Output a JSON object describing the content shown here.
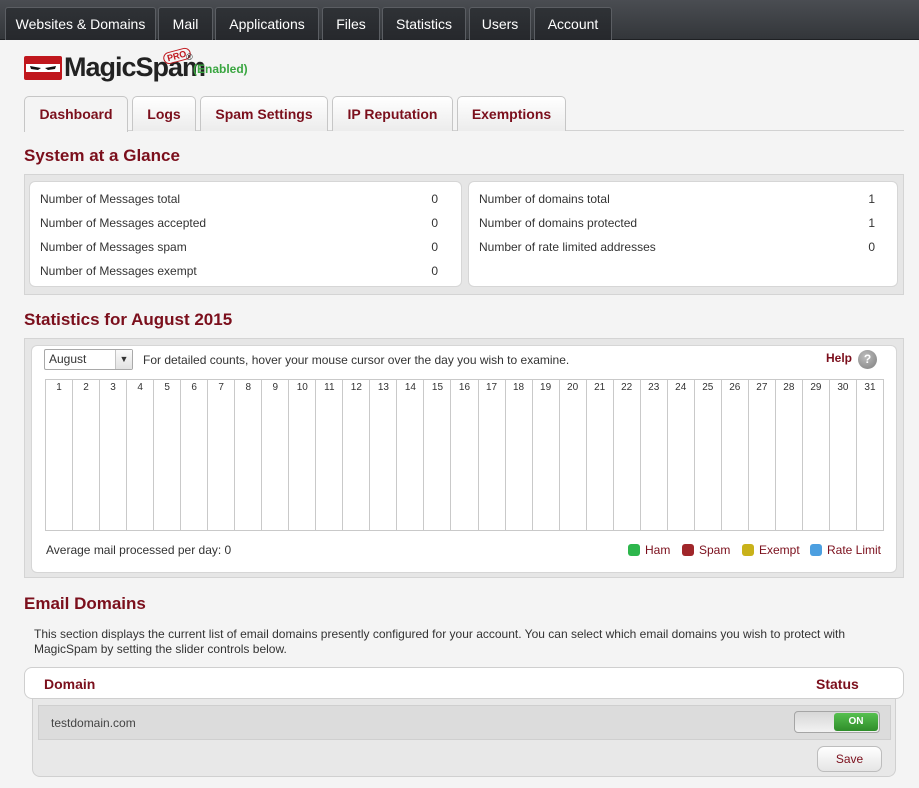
{
  "topnav": {
    "tabs": [
      {
        "label": "Websites & Domains"
      },
      {
        "label": "Mail"
      },
      {
        "label": "Applications"
      },
      {
        "label": "Files"
      },
      {
        "label": "Statistics"
      },
      {
        "label": "Users"
      },
      {
        "label": "Account"
      }
    ]
  },
  "logo": {
    "name": "MagicSpam",
    "badge": "PRO",
    "registered": "®",
    "status": "(Enabled)"
  },
  "subtabs": [
    {
      "label": "Dashboard",
      "active": true
    },
    {
      "label": "Logs"
    },
    {
      "label": "Spam Settings"
    },
    {
      "label": "IP Reputation"
    },
    {
      "label": "Exemptions"
    }
  ],
  "glance": {
    "title": "System at a Glance",
    "messages": [
      {
        "label": "Number of Messages total",
        "value": "0"
      },
      {
        "label": "Number of Messages accepted",
        "value": "0"
      },
      {
        "label": "Number of Messages spam",
        "value": "0"
      },
      {
        "label": "Number of Messages exempt",
        "value": "0"
      }
    ],
    "domains": [
      {
        "label": "Number of domains total",
        "value": "1"
      },
      {
        "label": "Number of domains protected",
        "value": "1"
      },
      {
        "label": "Number of rate limited addresses",
        "value": "0"
      }
    ]
  },
  "stats": {
    "title": "Statistics for August 2015",
    "month": "August",
    "hint": "For detailed counts, hover your mouse cursor over the day you wish to examine.",
    "help": "Help",
    "help_icon": "?",
    "days": [
      "1",
      "2",
      "3",
      "4",
      "5",
      "6",
      "7",
      "8",
      "9",
      "10",
      "11",
      "12",
      "13",
      "14",
      "15",
      "16",
      "17",
      "18",
      "19",
      "20",
      "21",
      "22",
      "23",
      "24",
      "25",
      "26",
      "27",
      "28",
      "29",
      "30",
      "31"
    ],
    "average": "Average mail processed per day: 0",
    "legend": [
      {
        "label": "Ham",
        "color": "#2db64c"
      },
      {
        "label": "Spam",
        "color": "#a0262a"
      },
      {
        "label": "Exempt",
        "color": "#c9b21a"
      },
      {
        "label": "Rate Limit",
        "color": "#4c9fe0"
      }
    ]
  },
  "domains": {
    "title": "Email Domains",
    "description": "This section displays the current list of email domains presently configured for your account. You can select which email domains you wish to protect with MagicSpam by setting the slider controls below.",
    "col_domain": "Domain",
    "col_status": "Status",
    "rows": [
      {
        "domain": "testdomain.com",
        "status": "ON"
      }
    ],
    "save": "Save"
  }
}
